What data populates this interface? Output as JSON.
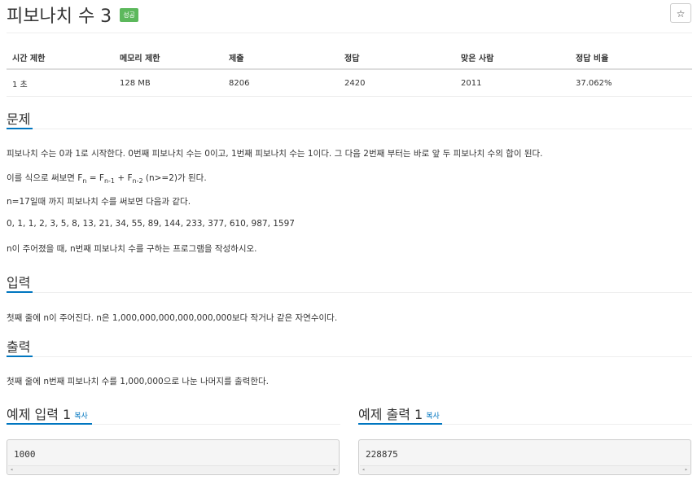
{
  "problem": {
    "title": "피보나치 수 3",
    "badge": "성공",
    "star_icon": "☆"
  },
  "info_table": {
    "headers": [
      "시간 제한",
      "메모리 제한",
      "제출",
      "정답",
      "맞은 사람",
      "정답 비율"
    ],
    "values": [
      "1 초",
      "128 MB",
      "8206",
      "2420",
      "2011",
      "37.062%"
    ]
  },
  "sections": {
    "description": {
      "heading": "문제",
      "line1": "피보나치 수는 0과 1로 시작한다. 0번째 피보나치 수는 0이고, 1번째 피보나치 수는 1이다. 그 다음 2번째 부터는 바로 앞 두 피보나치 수의 합이 된다.",
      "line2_prefix": "이를 식으로 써보면 F",
      "line2_sub_n": "n",
      "line2_eq": " = F",
      "line2_sub_n1": "n-1",
      "line2_plus": " + F",
      "line2_sub_n2": "n-2",
      "line2_suffix": " (n>=2)가 된다.",
      "line3": "n=17일때 까지 피보나치 수를 써보면 다음과 같다.",
      "line4": "0, 1, 1, 2, 3, 5, 8, 13, 21, 34, 55, 89, 144, 233, 377, 610, 987, 1597",
      "line5": "n이 주어졌을 때, n번째 피보나치 수를 구하는 프로그램을 작성하시오."
    },
    "input": {
      "heading": "입력",
      "text": "첫째 줄에 n이 주어진다. n은 1,000,000,000,000,000,000보다 작거나 같은 자연수이다."
    },
    "output": {
      "heading": "출력",
      "text": "첫째 줄에 n번째 피보나치 수를 1,000,000으로 나눈 나머지를 출력한다."
    }
  },
  "samples": {
    "input": {
      "heading": "예제 입력 1",
      "copy_label": "복사",
      "value": "1000"
    },
    "output": {
      "heading": "예제 출력 1",
      "copy_label": "복사",
      "value": "228875"
    }
  },
  "colors": {
    "accent": "#0076c0",
    "success": "#5cb85c"
  }
}
